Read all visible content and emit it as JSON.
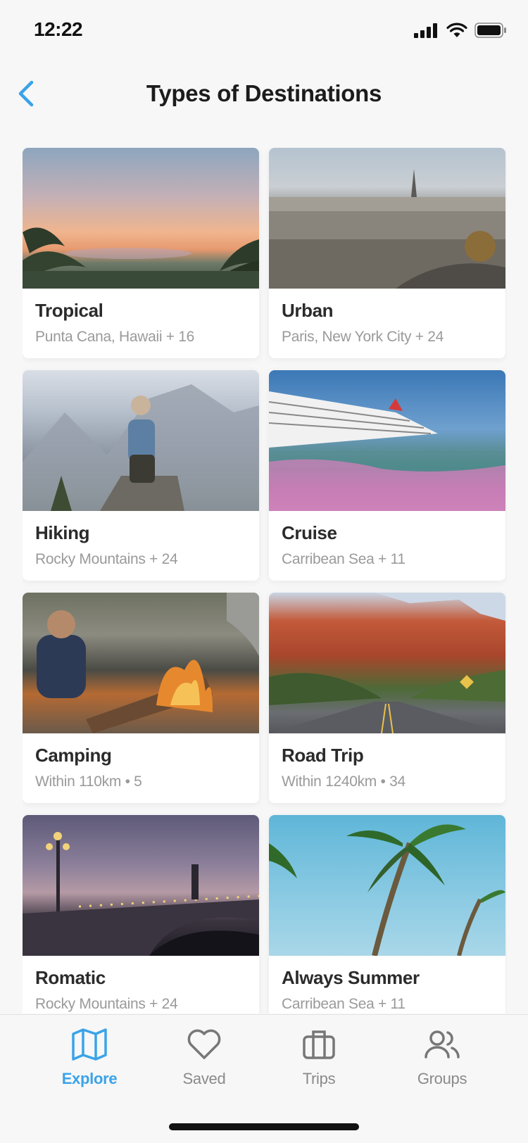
{
  "status_bar": {
    "time": "12:22"
  },
  "header": {
    "title": "Types of Destinations"
  },
  "destinations": [
    {
      "title": "Tropical",
      "subtitle": "Punta Cana, Hawaii + 16",
      "image": "tropical-sunset-palms"
    },
    {
      "title": "Urban",
      "subtitle": "Paris,  New York City + 24",
      "image": "paris-cityscape"
    },
    {
      "title": "Hiking",
      "subtitle": "Rocky Mountains + 24",
      "image": "hiker-yosemite"
    },
    {
      "title": "Cruise",
      "subtitle": "Carribean Sea + 11",
      "image": "cruise-ship-sea"
    },
    {
      "title": "Camping",
      "subtitle": "Within 110km • 5",
      "image": "campfire"
    },
    {
      "title": "Road Trip",
      "subtitle": "Within 1240km • 34",
      "image": "desert-road"
    },
    {
      "title": "Romatic",
      "subtitle": "Rocky Mountains + 24",
      "image": "paris-bridge-night"
    },
    {
      "title": "Always Summer",
      "subtitle": "Carribean Sea + 11",
      "image": "palm-trees-sky"
    }
  ],
  "tab_bar": {
    "tabs": [
      {
        "label": "Explore",
        "icon": "map-icon",
        "active": true
      },
      {
        "label": "Saved",
        "icon": "heart-icon",
        "active": false
      },
      {
        "label": "Trips",
        "icon": "briefcase-icon",
        "active": false
      },
      {
        "label": "Groups",
        "icon": "users-icon",
        "active": false
      }
    ]
  },
  "colors": {
    "accent": "#3aa3e8",
    "inactive": "#8a8a8a",
    "background": "#f7f7f7"
  }
}
